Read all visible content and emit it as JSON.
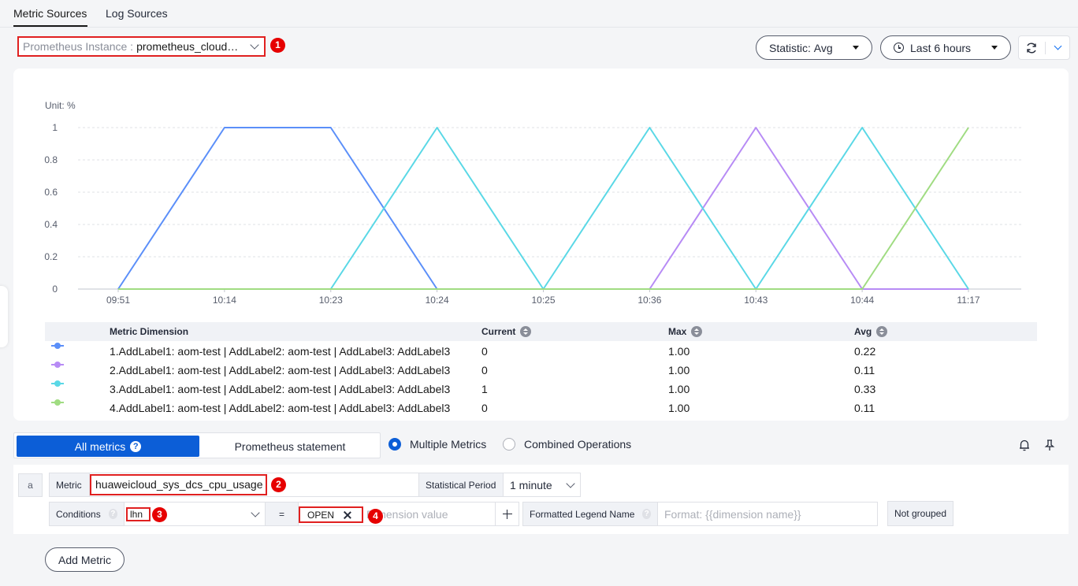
{
  "tabs": [
    {
      "label": "Metric Sources",
      "active": true
    },
    {
      "label": "Log Sources",
      "active": false
    }
  ],
  "instance": {
    "label": "Prometheus Instance :",
    "value": "prometheus_cloud…",
    "badge": "1"
  },
  "statistic": {
    "label": "Statistic:",
    "value": "Avg"
  },
  "time_range": {
    "value": "Last 6 hours"
  },
  "chart_data": {
    "type": "line",
    "unit_label": "Unit: %",
    "x": [
      "09:51",
      "10:14",
      "10:23",
      "10:24",
      "10:25",
      "10:36",
      "10:43",
      "10:44",
      "11:17"
    ],
    "y_ticks": [
      "0",
      "0.2",
      "0.4",
      "0.6",
      "0.8",
      "1"
    ],
    "ylim": [
      0,
      1
    ],
    "grid": true,
    "series": [
      {
        "color": "#5b8ff9",
        "values": [
          0,
          1,
          1,
          0,
          0,
          0,
          0,
          0,
          0
        ]
      },
      {
        "color": "#b78bf5",
        "values": [
          0,
          0,
          0,
          0,
          0,
          0,
          1,
          0,
          0
        ]
      },
      {
        "color": "#5ad8e6",
        "values": [
          0,
          0,
          0,
          1,
          0,
          1,
          0,
          1,
          0
        ]
      },
      {
        "color": "#a0dc82",
        "values": [
          0,
          0,
          0,
          0,
          0,
          0,
          0,
          0,
          1
        ]
      }
    ]
  },
  "legend_table": {
    "headers": {
      "dimension": "Metric Dimension",
      "current": "Current",
      "max": "Max",
      "avg": "Avg"
    },
    "rows": [
      {
        "color": "#5b8ff9",
        "dimension": "1.AddLabel1: aom-test | AddLabel2: aom-test | AddLabel3: AddLabel3",
        "current": "0",
        "max": "1.00",
        "avg": "0.22"
      },
      {
        "color": "#b78bf5",
        "dimension": "2.AddLabel1: aom-test | AddLabel2: aom-test | AddLabel3: AddLabel3",
        "current": "0",
        "max": "1.00",
        "avg": "0.11"
      },
      {
        "color": "#5ad8e6",
        "dimension": "3.AddLabel1: aom-test | AddLabel2: aom-test | AddLabel3: AddLabel3",
        "current": "1",
        "max": "1.00",
        "avg": "0.33"
      },
      {
        "color": "#a0dc82",
        "dimension": "4.AddLabel1: aom-test | AddLabel2: aom-test | AddLabel3: AddLabel3",
        "current": "0",
        "max": "1.00",
        "avg": "0.11"
      }
    ]
  },
  "mode": {
    "all_metrics": "All metrics",
    "help": "?",
    "prometheus_statement": "Prometheus statement"
  },
  "radios": {
    "multiple": "Multiple Metrics",
    "combined": "Combined Operations"
  },
  "query": {
    "row_id": "a",
    "metric_label": "Metric",
    "metric_value": "huaweicloud_sys_dcs_cpu_usage",
    "metric_badge": "2",
    "period_label": "Statistical Period",
    "period_value": "1 minute",
    "conditions_label": "Conditions",
    "condition_key": "lhn",
    "condition_badge": "3",
    "operator": "=",
    "condition_tag": "OPEN",
    "condition_placeholder": "Dimension value",
    "condition_tag_badge": "4",
    "legend_label": "Formatted Legend Name",
    "legend_placeholder": "Format: {{dimension name}}",
    "grouping": "Not grouped"
  },
  "add_metric": "Add Metric",
  "colors": {
    "accent": "#0c5ed7",
    "highlight": "#e02020"
  }
}
